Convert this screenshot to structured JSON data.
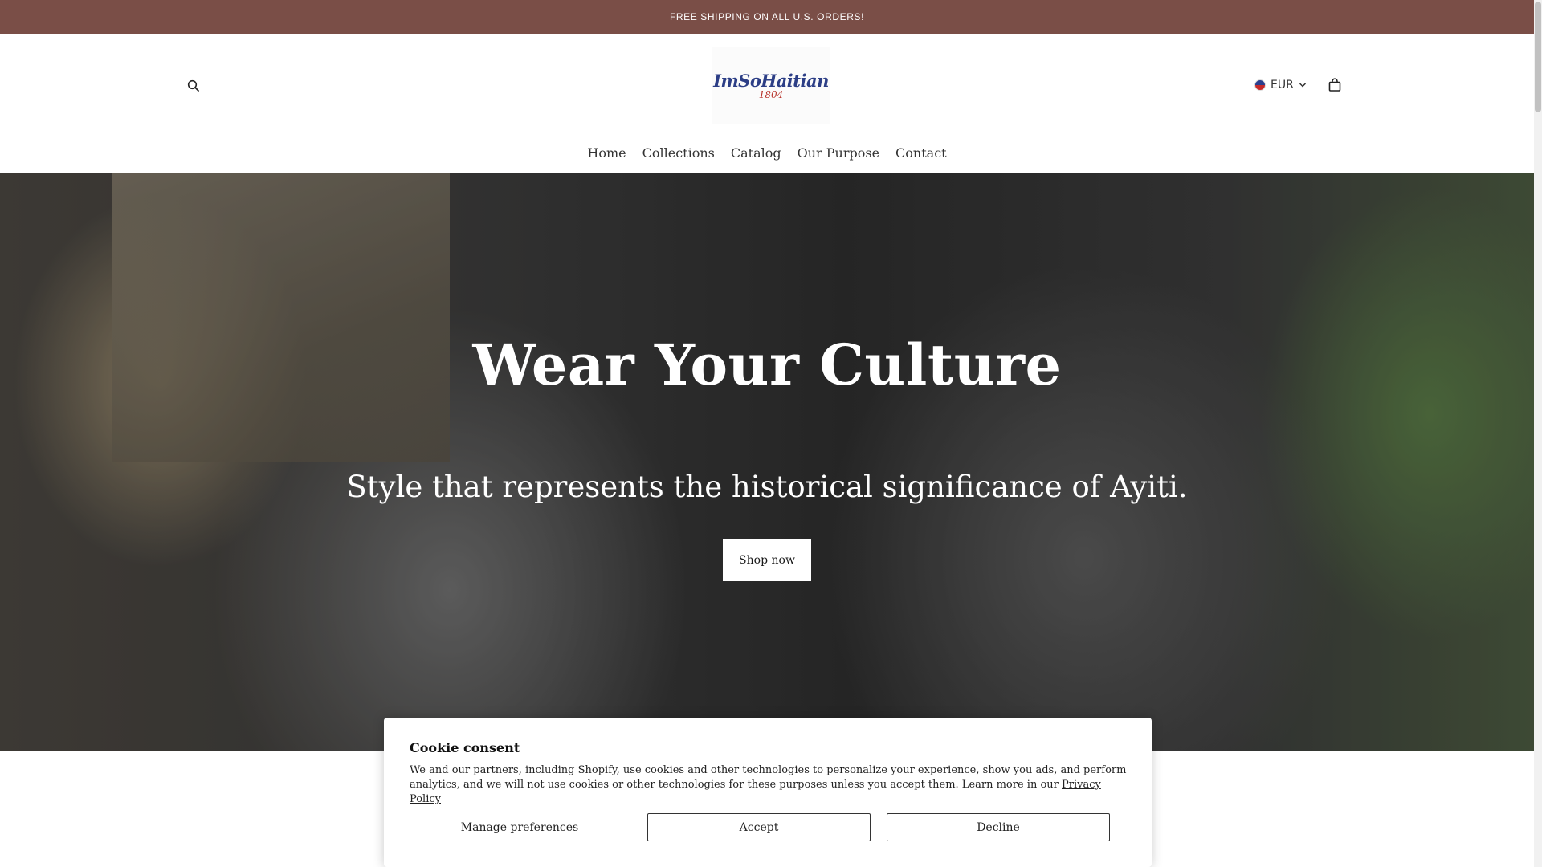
{
  "announcement": {
    "text": "FREE SHIPPING ON ALL U.S. ORDERS!"
  },
  "header": {
    "logo": {
      "script": "ImSoHaitian",
      "year": "1804"
    },
    "currency": {
      "code": "EUR",
      "flag": "haiti-flag-icon"
    },
    "icons": {
      "search": "search-icon",
      "cart": "cart-icon",
      "chevron": "chevron-down-icon"
    }
  },
  "nav": {
    "items": [
      "Home",
      "Collections",
      "Catalog",
      "Our Purpose",
      "Contact"
    ]
  },
  "hero": {
    "heading": "Wear Your Culture",
    "subheading": "Style that represents the historical significance of Ayiti.",
    "button_label": "Shop now"
  },
  "cookie": {
    "title": "Cookie consent",
    "body": "We and our partners, including Shopify, use cookies and other technologies to personalize your experience, show you ads, and perform analytics, and we will not use cookies or other technologies for these purposes unless you accept them. Learn more in our",
    "privacy_link": "Privacy Policy",
    "manage_label": "Manage preferences",
    "accept_label": "Accept",
    "decline_label": "Decline"
  },
  "colors": {
    "announcement_bg": "#7a4e47",
    "logo_blue": "#2c3e86",
    "logo_red": "#b8342c"
  }
}
